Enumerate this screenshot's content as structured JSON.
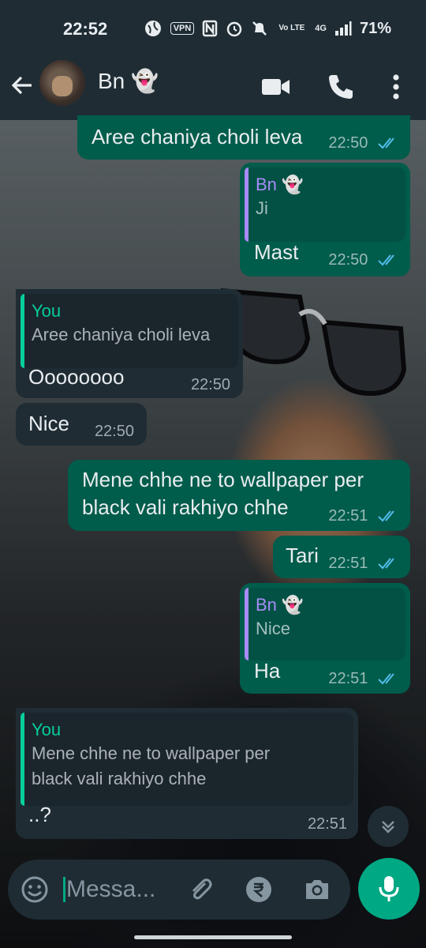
{
  "status_bar": {
    "time": "22:52",
    "vpn": "VPN",
    "vo_lte": "Vo LTE",
    "network": "4G",
    "battery": "71%"
  },
  "header": {
    "contact_name": "Bn 👻"
  },
  "messages": [
    {
      "direction": "out",
      "text": "Aree chaniya choli leva",
      "time": "22:50",
      "read": true
    },
    {
      "direction": "out",
      "quote": {
        "author": "Bn 👻",
        "text": "Ji"
      },
      "text": "Mast",
      "time": "22:50",
      "read": true
    },
    {
      "direction": "in",
      "quote": {
        "author": "You",
        "text": "Aree chaniya choli leva"
      },
      "text": "Oooooooo",
      "time": "22:50"
    },
    {
      "direction": "in",
      "text": "Nice",
      "time": "22:50"
    },
    {
      "direction": "out",
      "text_line1": "Mene chhe ne to wallpaper per",
      "text_line2": "black vali rakhiyo chhe",
      "time": "22:51",
      "read": true
    },
    {
      "direction": "out",
      "text": "Tari",
      "time": "22:51",
      "read": true
    },
    {
      "direction": "out",
      "quote": {
        "author": "Bn 👻",
        "text": "Nice"
      },
      "text": "Ha",
      "time": "22:51",
      "read": true
    },
    {
      "direction": "in",
      "quote": {
        "author": "You",
        "text_line1": "Mene chhe ne to wallpaper per",
        "text_line2": "black vali rakhiyo chhe"
      },
      "text": "..?",
      "time": "22:51"
    }
  ],
  "composer": {
    "placeholder": "Messa..."
  },
  "colors": {
    "accent": "#00a884",
    "outgoing_bubble": "#005c4b",
    "incoming_bubble": "#1f2c34",
    "quote_you": "#06cf9c",
    "quote_contact": "#a78bfa",
    "read_ticks": "#53bdeb"
  }
}
